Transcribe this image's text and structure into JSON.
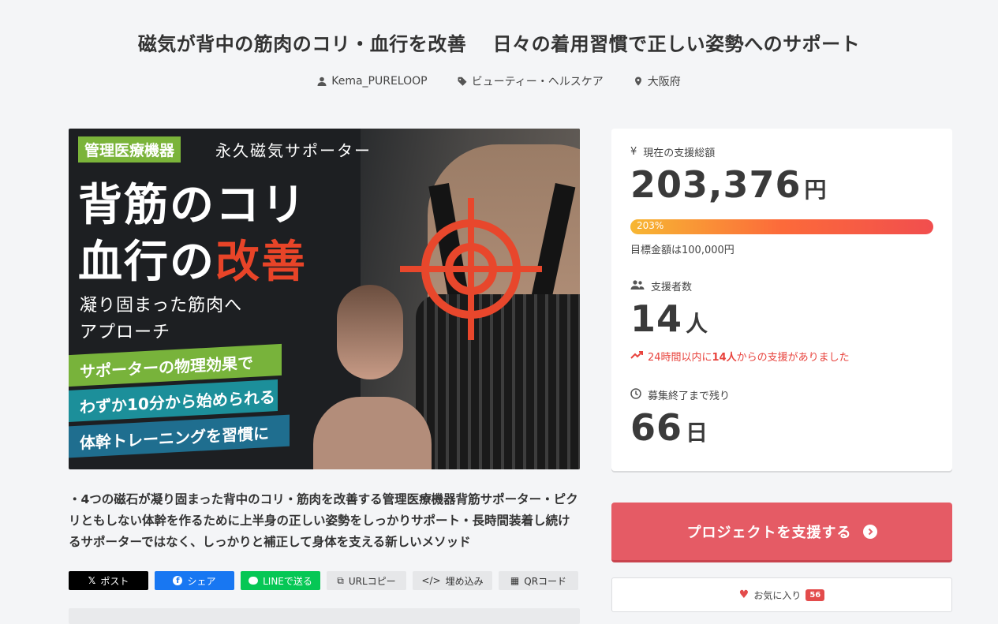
{
  "title": "磁気が背中の筋肉のコリ・血行を改善　 日々の着用習慣で正しい姿勢へのサポート",
  "meta": {
    "owner": "Kema_PURELOOP",
    "category": "ビューティー・ヘルスケア",
    "location": "大阪府"
  },
  "hero": {
    "tag": "管理医療機器",
    "tag2": "永久磁気サポーター",
    "headline1": "背筋のコリ",
    "headline2_prefix": "血行の",
    "headline2_red": "改善",
    "sub1": "凝り固まった筋肉へ",
    "sub2": "アプローチ",
    "band1": "サポーターの物理効果で",
    "band2": "わずか10分から始められる",
    "band3": "体幹トレーニングを習慣に"
  },
  "description": "・4つの磁石が凝り固まった背中のコリ・筋肉を改善する管理医療機器背筋サポーター・ピクリともしない体幹を作るために上半身の正しい姿勢をしっかりサポート・長時間装着し続けるサポーターではなく、しっかりと補正して身体を支える新しいメソッド",
  "share": {
    "x": "ポスト",
    "facebook": "シェア",
    "line": "LINEで送る",
    "url": "URLコピー",
    "embed": "埋め込み",
    "qr": "QRコード"
  },
  "stats": {
    "total_label": "現在の支援総額",
    "total_value": "203,376",
    "total_unit": "円",
    "percent": "203%",
    "goal": "目標金額は100,000円",
    "backers_label": "支援者数",
    "backers_value": "14",
    "backers_unit": "人",
    "trend_prefix": "24時間以内に",
    "trend_count": "14人",
    "trend_suffix": "からの支援がありました",
    "remaining_label": "募集終了まで残り",
    "remaining_value": "66",
    "remaining_unit": "日"
  },
  "support_button": "プロジェクトを支援する",
  "favorite": {
    "label": "お気に入り",
    "count": "56"
  },
  "colors": {
    "accent": "#e55b65",
    "trend": "#e8433d"
  }
}
